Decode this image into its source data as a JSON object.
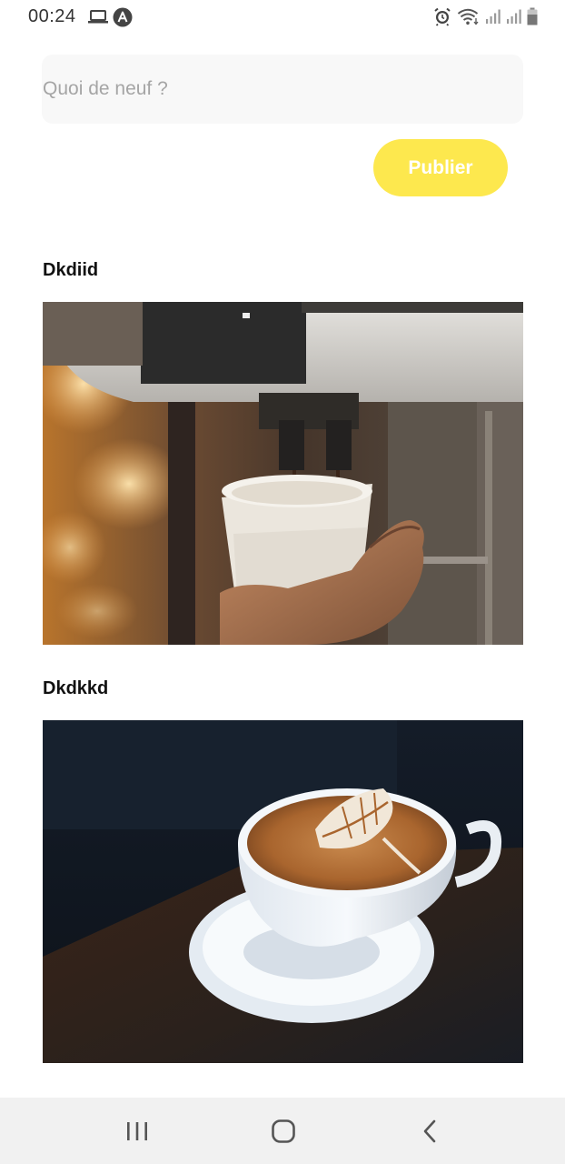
{
  "status_bar": {
    "time": "00:24",
    "left_icons": [
      "laptop-icon",
      "app-notification-icon"
    ],
    "right_icons": [
      "alarm-icon",
      "wifi-icon",
      "signal-icon",
      "signal-icon",
      "battery-icon"
    ]
  },
  "composer": {
    "placeholder": "Quoi de neuf ?",
    "value": "",
    "publish_label": "Publier"
  },
  "posts": [
    {
      "title": "Dkdiid",
      "image": "coffee-machine-cup-photo"
    },
    {
      "title": "Dkdkkd",
      "image": "latte-art-cup-photo"
    }
  ],
  "nav_bar": {
    "buttons": [
      "recent-apps-icon",
      "home-icon",
      "back-icon"
    ]
  },
  "colors": {
    "accent": "#fde84e",
    "input_background": "#f8f8f8",
    "nav_background": "#f1f1f1"
  }
}
